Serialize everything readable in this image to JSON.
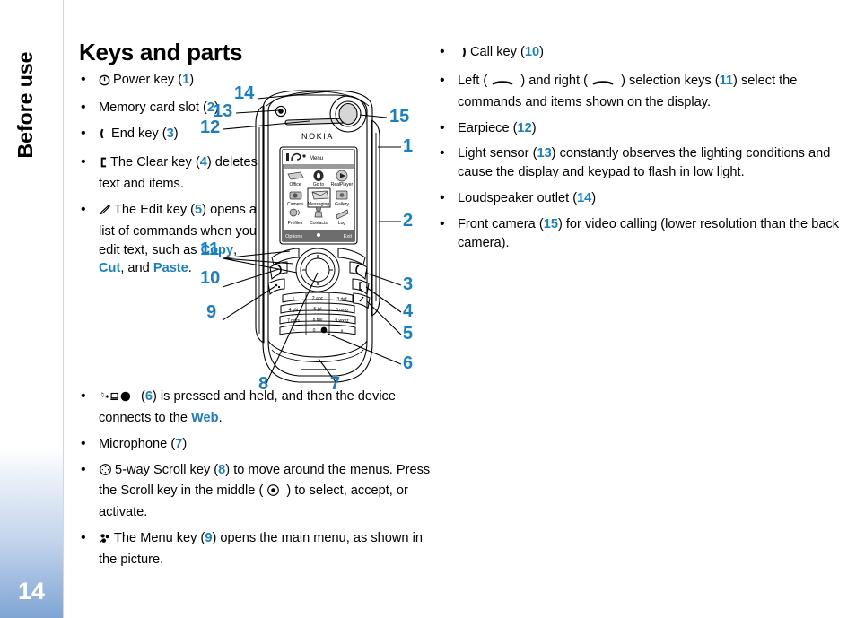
{
  "sidebar": {
    "chapter": "Before use",
    "page_number": "14"
  },
  "main": {
    "title": "Keys and parts"
  },
  "left_column": {
    "items": [
      {
        "id": "power-key",
        "icon": "power-icon",
        "text_before": "",
        "label": "Power key",
        "ref": "1",
        "text_after": ""
      },
      {
        "id": "memory-card-slot",
        "icon": "",
        "text_before": "",
        "label": "Memory card slot",
        "ref": "2",
        "text_after": ""
      },
      {
        "id": "end-key",
        "icon": "end-call-icon",
        "text_before": "",
        "label": "End key",
        "ref": "3",
        "text_after": ""
      },
      {
        "id": "clear-key",
        "icon": "clear-key-icon",
        "text_before": "The Clear key (",
        "label": "The Clear key",
        "ref": "4",
        "text_after": ") deletes text and items."
      },
      {
        "id": "edit-key",
        "icon": "pencil-edit-icon",
        "text_before": "The Edit key (",
        "label": "The Edit key",
        "ref": "5",
        "text_after": ") opens a list of commands when you edit text, such as ",
        "keywords": [
          "Copy",
          "Cut",
          "Paste"
        ],
        "tail": "."
      }
    ],
    "wide_items": [
      {
        "id": "web-key",
        "icon": "multimedia-web-icon",
        "ref": "6",
        "text_after": ") is pressed and held, and then the device connects to the ",
        "keyword": "Web",
        "tail": "."
      },
      {
        "id": "microphone",
        "label": "Microphone",
        "ref": "7"
      },
      {
        "id": "scroll-key",
        "icon": "scroll-key-icon",
        "text_before": "5-way Scroll key (",
        "ref": "8",
        "text_mid": ") to move around the menus. Press the Scroll key in the middle ( ",
        "inline_icon": "scroll-center-icon",
        "text_after": " ) to select, accept, or activate."
      },
      {
        "id": "menu-key",
        "icon": "menu-key-icon",
        "text_before": "The Menu key (",
        "ref": "9",
        "text_after": ") opens the main menu, as shown in the picture."
      }
    ]
  },
  "right_column": {
    "items": [
      {
        "id": "call-key",
        "icon": "call-icon",
        "label": "Call key",
        "ref": "10",
        "text_after": ""
      },
      {
        "id": "selection-keys",
        "text_before": "Left ( ",
        "icon_left": "dash-icon",
        "text_mid": " ) and right ( ",
        "icon_right": "dash-icon",
        "text_mid2": " ) selection keys (",
        "ref": "11",
        "text_after": ") select the commands and items shown on the display."
      },
      {
        "id": "earpiece",
        "label": "Earpiece",
        "ref": "12",
        "text_after": ""
      },
      {
        "id": "light-sensor",
        "label": "Light sensor",
        "ref": "13",
        "text_after": ") constantly observes the lighting conditions and cause the display and keypad to flash in low light."
      },
      {
        "id": "loudspeaker-outlet",
        "label": "Loudspeaker outlet",
        "ref": "14",
        "text_after": ""
      },
      {
        "id": "front-camera",
        "label": "Front camera",
        "ref": "15",
        "text_after": ") for video calling (lower resolution than the back camera)."
      }
    ]
  },
  "figure": {
    "brand": "NOKIA",
    "callouts_left": [
      "14",
      "13",
      "12",
      "11",
      "10",
      "9"
    ],
    "callouts_right": [
      "15",
      "1",
      "2",
      "3",
      "4",
      "5",
      "6"
    ],
    "callouts_bottom": [
      "8",
      "7"
    ],
    "screen": {
      "title": "Menu",
      "soft_left": "Options",
      "soft_right": "Exit",
      "menu_items": [
        "Office",
        "Go to",
        "RealPlayer",
        "Camera",
        "Messaging",
        "Gallery",
        "Profiles",
        "Contacts",
        "Log"
      ],
      "selected": "Messaging"
    },
    "keypad": [
      "1",
      "2 abc",
      "3 def",
      "4 ghi",
      "5 jkl",
      "6 mno",
      "7 pqrs",
      "8 tuv",
      "9 wxyz",
      "*",
      "0",
      "#"
    ]
  },
  "colors": {
    "accent_blue": "#1a7fc1",
    "sidebar_blue": "#7fa5d4",
    "rule": "#cfd9e3"
  }
}
